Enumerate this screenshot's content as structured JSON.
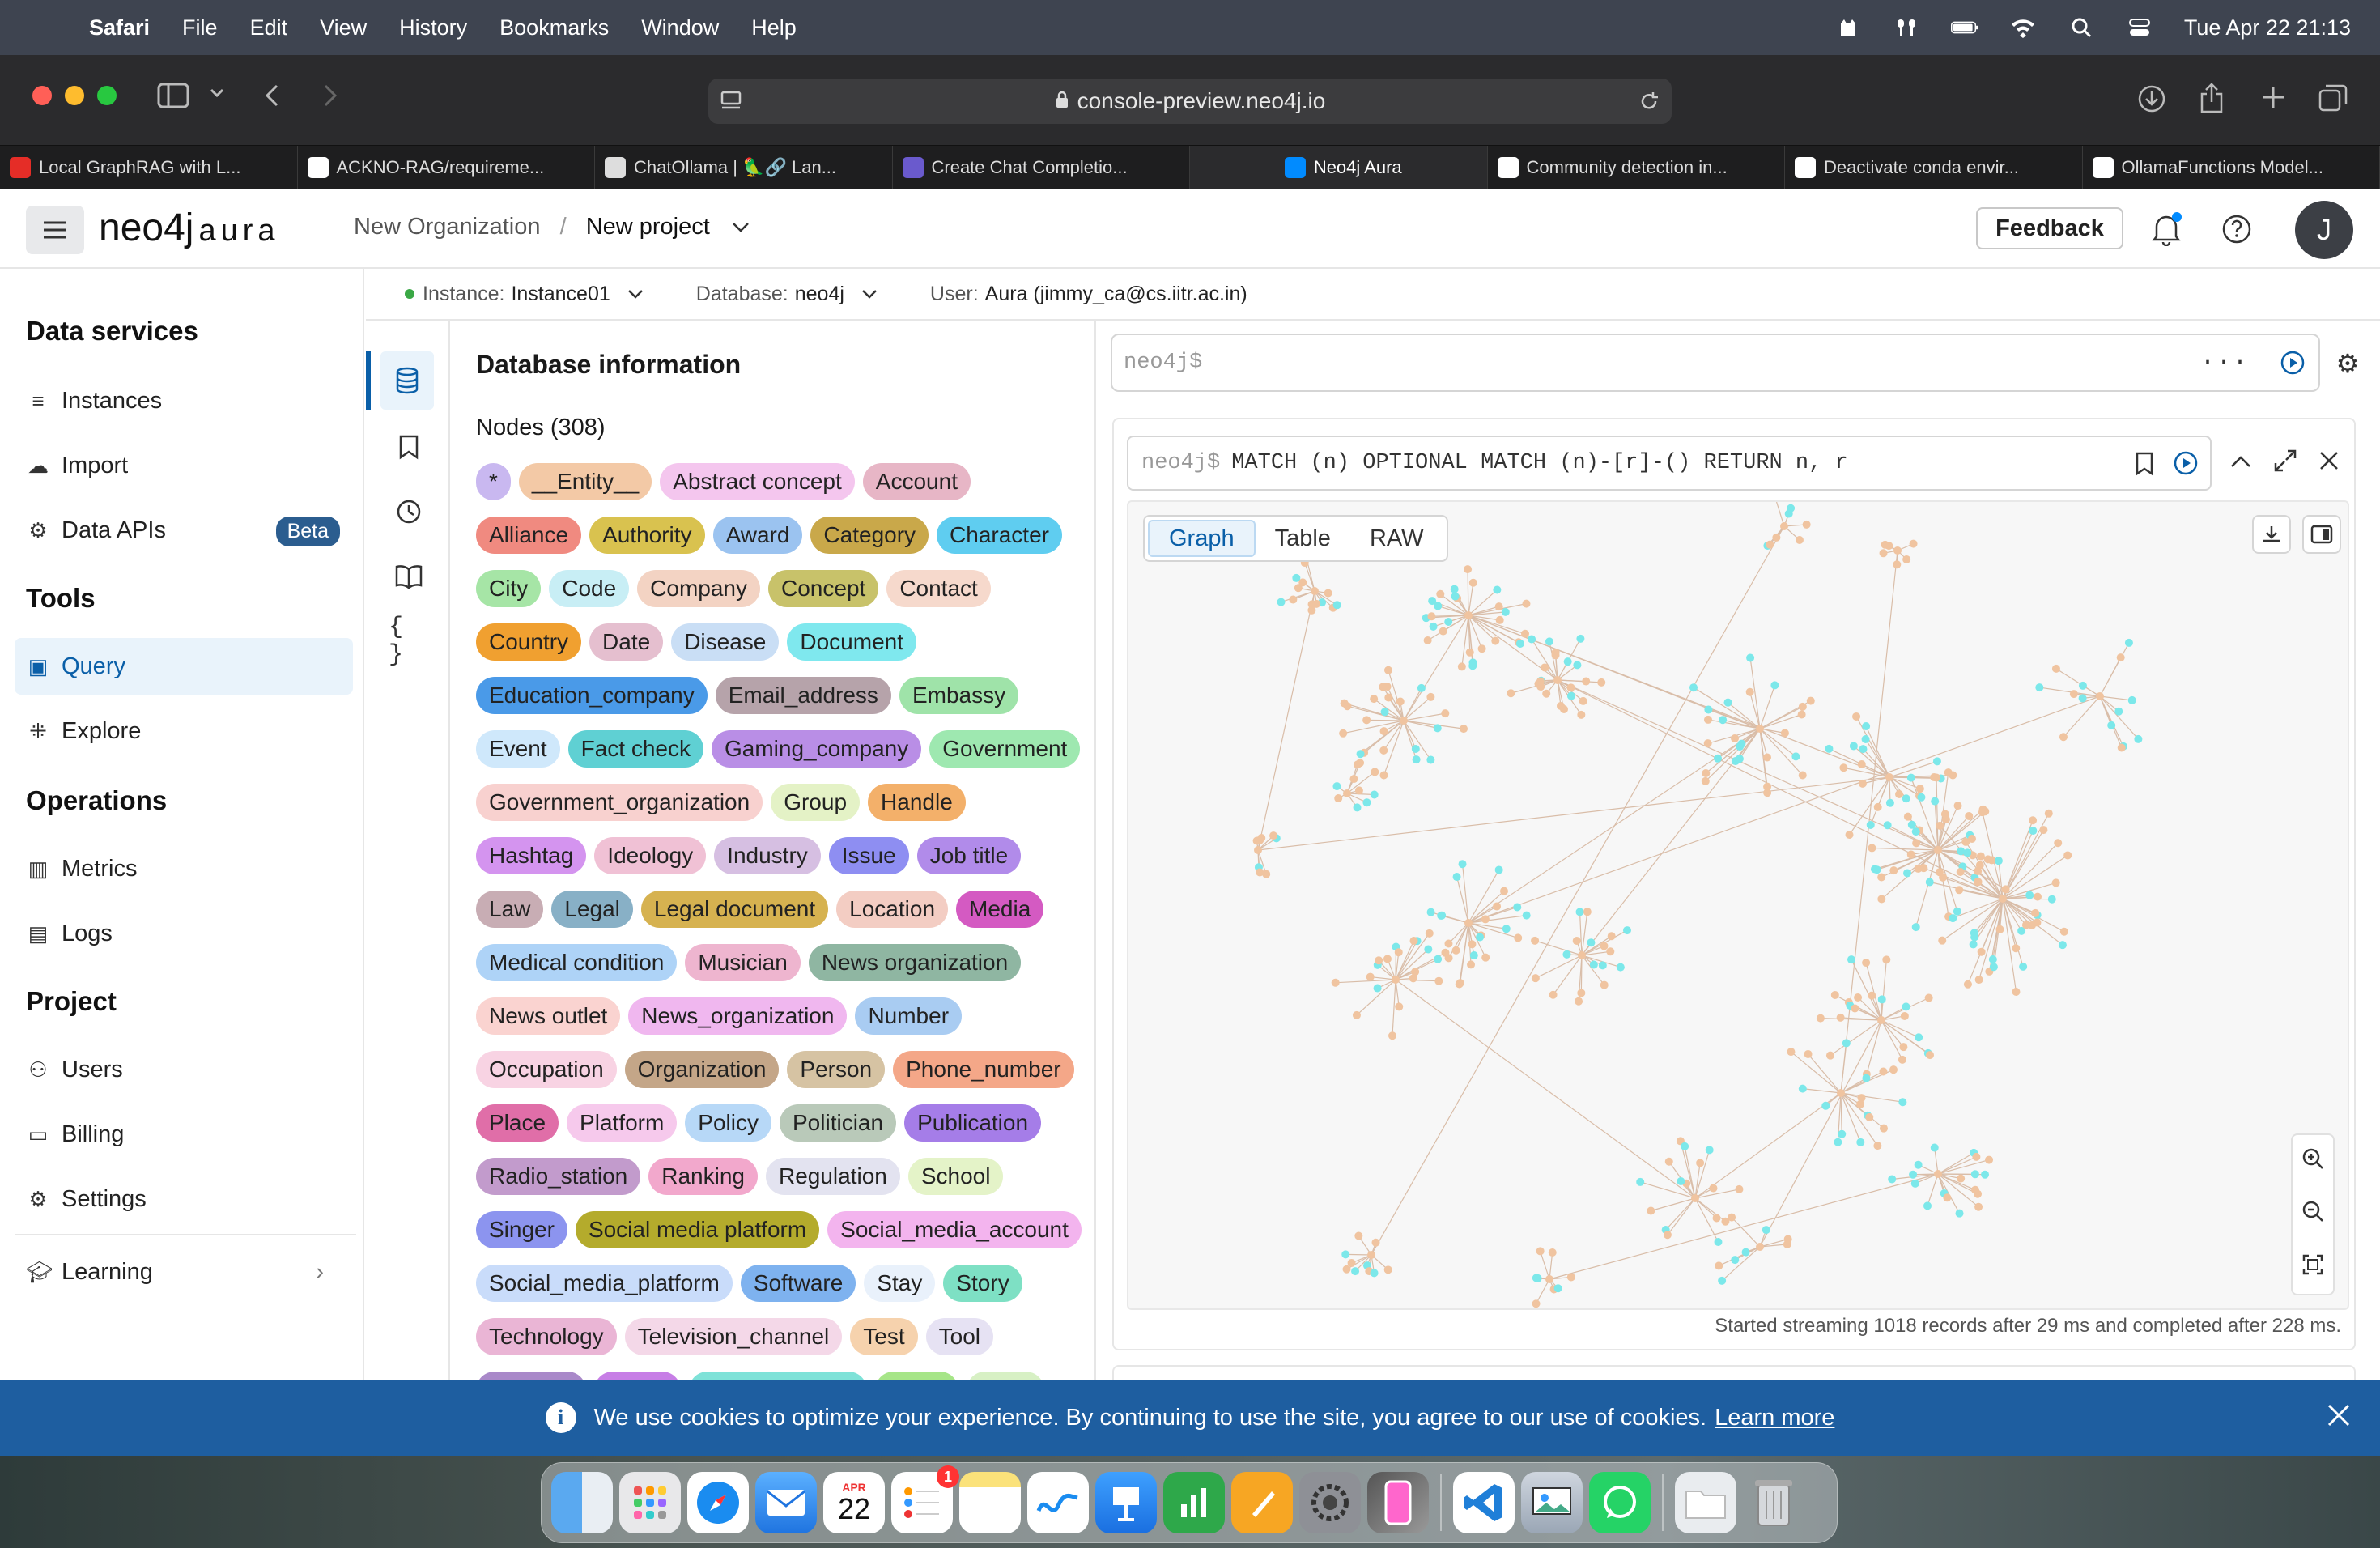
{
  "menubar": {
    "app": "Safari",
    "items": [
      "File",
      "Edit",
      "View",
      "History",
      "Bookmarks",
      "Window",
      "Help"
    ],
    "clock": "Tue Apr 22  21:13"
  },
  "browser": {
    "url": "console-preview.neo4j.io",
    "tabs": [
      {
        "label": "Local GraphRAG with L...",
        "icon": "youtube-icon",
        "color": "#e52d27"
      },
      {
        "label": "ACKNO-RAG/requireme...",
        "icon": "github-icon",
        "color": "#ffffff"
      },
      {
        "label": "ChatOllama | 🦜🔗 Lan...",
        "icon": "chat-icon",
        "color": "#dddddd"
      },
      {
        "label": "Create Chat Completio...",
        "icon": "link-icon",
        "color": "#6a5acd"
      },
      {
        "label": "Neo4j Aura",
        "icon": "neo4j-icon",
        "color": "#018bff"
      },
      {
        "label": "Community detection in...",
        "icon": "medium-icon",
        "color": "#ffffff"
      },
      {
        "label": "Deactivate conda envir...",
        "icon": "openai-icon",
        "color": "#ffffff"
      },
      {
        "label": "OllamaFunctions Model...",
        "icon": "openai-icon",
        "color": "#ffffff"
      }
    ]
  },
  "header": {
    "logo": "neo4j",
    "logo_suffix": "aura",
    "org": "New Organization",
    "separator": "/",
    "project": "New project",
    "feedback": "Feedback",
    "avatar": "J"
  },
  "sidebar": {
    "data_services": "Data services",
    "instances": "Instances",
    "import": "Import",
    "data_apis": "Data APIs",
    "beta": "Beta",
    "tools": "Tools",
    "query": "Query",
    "explore": "Explore",
    "operations": "Operations",
    "metrics": "Metrics",
    "logs": "Logs",
    "project": "Project",
    "users": "Users",
    "billing": "Billing",
    "settings": "Settings",
    "learning": "Learning"
  },
  "instance_bar": {
    "instance_label": "Instance:",
    "instance_value": "Instance01",
    "database_label": "Database:",
    "database_value": "neo4j",
    "user_label": "User:",
    "user_value": "Aura (jimmy_ca@cs.iitr.ac.in)"
  },
  "dbinfo": {
    "title": "Database information",
    "nodes_title": "Nodes (308)",
    "labels": [
      {
        "t": "*",
        "c": "#c9b8f0"
      },
      {
        "t": "__Entity__",
        "c": "#f3c9a6"
      },
      {
        "t": "Abstract concept",
        "c": "#f4c6ee"
      },
      {
        "t": "Account",
        "c": "#e7b6c6"
      },
      {
        "t": "Alliance",
        "c": "#f08a80"
      },
      {
        "t": "Authority",
        "c": "#d9c24f"
      },
      {
        "t": "Award",
        "c": "#9bc3f0"
      },
      {
        "t": "Category",
        "c": "#c9a84a"
      },
      {
        "t": "Character",
        "c": "#5fcdf0"
      },
      {
        "t": "City",
        "c": "#a6e5a6"
      },
      {
        "t": "Code",
        "c": "#c8eef5"
      },
      {
        "t": "Company",
        "c": "#f3d3c3"
      },
      {
        "t": "Concept",
        "c": "#c8c26a"
      },
      {
        "t": "Contact",
        "c": "#f6d9cc"
      },
      {
        "t": "Country",
        "c": "#f0a030"
      },
      {
        "t": "Date",
        "c": "#e5bfcf"
      },
      {
        "t": "Disease",
        "c": "#c9def5"
      },
      {
        "t": "Document",
        "c": "#7fe8ee"
      },
      {
        "t": "Education_company",
        "c": "#4a9ae8"
      },
      {
        "t": "Email_address",
        "c": "#b6a3aa"
      },
      {
        "t": "Embassy",
        "c": "#9fe3a9"
      },
      {
        "t": "Event",
        "c": "#cfe8fb"
      },
      {
        "t": "Fact check",
        "c": "#5fd0d3"
      },
      {
        "t": "Gaming_company",
        "c": "#b98ee6"
      },
      {
        "t": "Government",
        "c": "#9ee8b0"
      },
      {
        "t": "Government_organization",
        "c": "#f8d1cf"
      },
      {
        "t": "Group",
        "c": "#e4f2c6"
      },
      {
        "t": "Handle",
        "c": "#f3b06a"
      },
      {
        "t": "Hashtag",
        "c": "#d494ef"
      },
      {
        "t": "Ideology",
        "c": "#f0c1d5"
      },
      {
        "t": "Industry",
        "c": "#d6bfe2"
      },
      {
        "t": "Issue",
        "c": "#8e8ef2"
      },
      {
        "t": "Job title",
        "c": "#b18bea"
      },
      {
        "t": "Law",
        "c": "#c8adb4"
      },
      {
        "t": "Legal",
        "c": "#88b0c6"
      },
      {
        "t": "Legal document",
        "c": "#d6b250"
      },
      {
        "t": "Location",
        "c": "#f3cdc3"
      },
      {
        "t": "Media",
        "c": "#d45ac2"
      },
      {
        "t": "Medical condition",
        "c": "#aed3f7"
      },
      {
        "t": "Musician",
        "c": "#eeb5cf"
      },
      {
        "t": "News organization",
        "c": "#8fb6a2"
      },
      {
        "t": "News outlet",
        "c": "#fad3d0"
      },
      {
        "t": "News_organization",
        "c": "#f0b7ef"
      },
      {
        "t": "Number",
        "c": "#a9ccf2"
      },
      {
        "t": "Occupation",
        "c": "#f8d3e3"
      },
      {
        "t": "Organization",
        "c": "#c4a688"
      },
      {
        "t": "Person",
        "c": "#d6c3a3"
      },
      {
        "t": "Phone_number",
        "c": "#f4a788"
      },
      {
        "t": "Place",
        "c": "#e06ea8"
      },
      {
        "t": "Platform",
        "c": "#f6c9ec"
      },
      {
        "t": "Policy",
        "c": "#b7d8f7"
      },
      {
        "t": "Politician",
        "c": "#b9c9b9"
      },
      {
        "t": "Publication",
        "c": "#a57de8"
      },
      {
        "t": "Radio_station",
        "c": "#c29bcc"
      },
      {
        "t": "Ranking",
        "c": "#f2a8cc"
      },
      {
        "t": "Regulation",
        "c": "#e3e3f0"
      },
      {
        "t": "School",
        "c": "#e4f3c8"
      },
      {
        "t": "Singer",
        "c": "#8c94ef"
      },
      {
        "t": "Social media platform",
        "c": "#b4ab2c"
      },
      {
        "t": "Social_media_account",
        "c": "#f3b4ee"
      },
      {
        "t": "Social_media_platform",
        "c": "#c9dcfa"
      },
      {
        "t": "Software",
        "c": "#7eb2ef"
      },
      {
        "t": "Stay",
        "c": "#e9f1fb"
      },
      {
        "t": "Story",
        "c": "#7ee0c4"
      },
      {
        "t": "Technology",
        "c": "#eab5d5"
      },
      {
        "t": "Television_channel",
        "c": "#f4d8e8"
      },
      {
        "t": "Test",
        "c": "#f6d2ad"
      },
      {
        "t": "Tool",
        "c": "#e6e2f3"
      },
      {
        "t": "Tv show",
        "c": "#a989c9"
      },
      {
        "t": "Tweet",
        "c": "#c77ee6"
      },
      {
        "t": "Twitter account",
        "c": "#7ee2d8"
      },
      {
        "t": "Video",
        "c": "#a6e588"
      },
      {
        "t": "Virus",
        "c": "#d7f0c4"
      }
    ]
  },
  "editor": {
    "placeholder": "neo4j$"
  },
  "result": {
    "prompt": "neo4j$",
    "query": "MATCH (n) OPTIONAL MATCH (n)-[r]-() RETURN n, r",
    "tabs": [
      "Graph",
      "Table",
      "RAW"
    ],
    "status": "Started streaming 1018 records after 29 ms and completed after 228 ms."
  },
  "cookie": {
    "text": "We use cookies to optimize your experience. By continuing to use the site, you agree to our use of cookies.",
    "link": "Learn more"
  },
  "dock": {
    "calendar_month": "APR",
    "calendar_day": "22",
    "reminders_badge": "1"
  },
  "graph_colors": {
    "node_a": "#f0c4a0",
    "node_b": "#7ce8ea",
    "edge": "#d9bda8"
  }
}
